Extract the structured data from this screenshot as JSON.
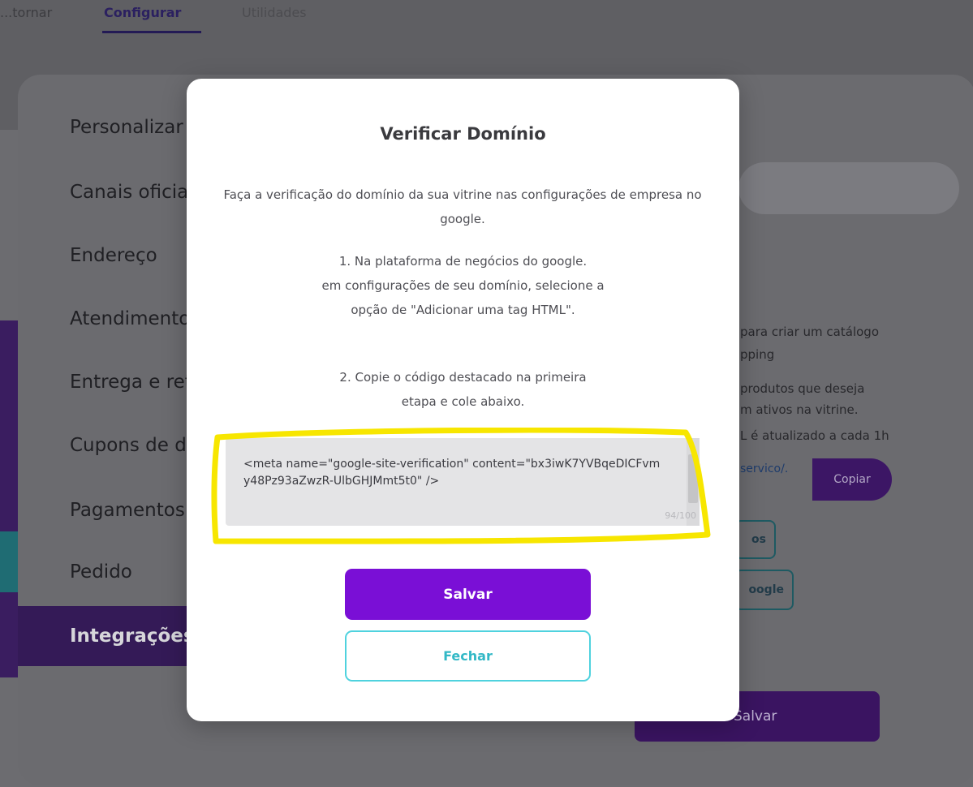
{
  "top_tabs": [
    "...tornar",
    "Configurar",
    "Utilidades"
  ],
  "menu": {
    "items": [
      {
        "label": "Personalizar"
      },
      {
        "label": "Canais oficiais"
      },
      {
        "label": "Endereço"
      },
      {
        "label": "Atendimento"
      },
      {
        "label": "Entrega e retirada"
      },
      {
        "label": "Cupons de desconto"
      },
      {
        "label": "Pagamentos"
      },
      {
        "label": "Pedido"
      },
      {
        "label": "Integrações",
        "active": true
      }
    ]
  },
  "right_pane": {
    "line1": "para criar um catálogo",
    "line2": "pping",
    "line3": "produtos que deseja",
    "line4": "m ativos na vitrine.",
    "line5": "L é atualizado a cada 1h",
    "url_fragment": "servico/.",
    "copy_label": "Copiar",
    "outline1_label": "os",
    "outline2_label": "oogle",
    "save_label": "Salvar"
  },
  "modal": {
    "title": "Verificar Domínio",
    "description": "Faça a verificação do domínio da sua vitrine nas configurações de empresa no google.",
    "step1_line1": "1. Na plataforma de negócios do google.",
    "step1_line2": "em configurações de seu domínio, selecione a",
    "step1_line3": "opção de \"Adicionar uma tag HTML\".",
    "step2_line1": "2. Copie o código destacado na primeira",
    "step2_line2": "etapa e cole abaixo.",
    "code_value": "<meta name=\"google-site-verification\" content=\"bx3iwK7YVBqeDICFvmy48Pz93aZwzR-UlbGHJMmt5t0\" />",
    "counter": "94/100",
    "save_label": "Salvar",
    "close_label": "Fechar"
  },
  "colors": {
    "primary": "#7a0fd6",
    "secondary_outline": "#4fd2de",
    "highlight": "#f7e600"
  }
}
